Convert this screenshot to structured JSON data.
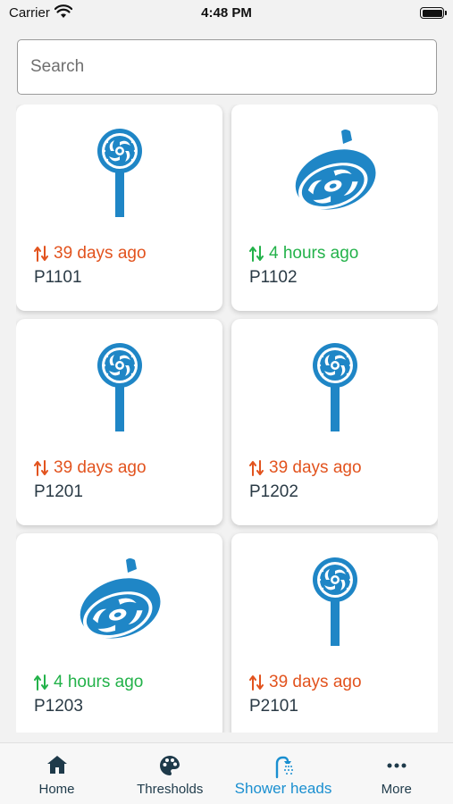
{
  "status_bar": {
    "carrier": "Carrier",
    "time": "4:48 PM"
  },
  "search": {
    "placeholder": "Search"
  },
  "colors": {
    "accent": "#1a8fd0",
    "stale": "#e2531e",
    "fresh": "#23b24a",
    "icon": "#1f86c6"
  },
  "cards": [
    {
      "id": "P1101",
      "time": "39 days ago",
      "status": "stale",
      "icon": "handheld-shower-head-icon"
    },
    {
      "id": "P1102",
      "time": "4 hours ago",
      "status": "fresh",
      "icon": "rain-shower-head-icon"
    },
    {
      "id": "P1201",
      "time": "39 days ago",
      "status": "stale",
      "icon": "handheld-shower-head-icon"
    },
    {
      "id": "P1202",
      "time": "39 days ago",
      "status": "stale",
      "icon": "handheld-shower-head-icon"
    },
    {
      "id": "P1203",
      "time": "4 hours ago",
      "status": "fresh",
      "icon": "rain-shower-head-icon"
    },
    {
      "id": "P2101",
      "time": "39 days ago",
      "status": "stale",
      "icon": "handheld-shower-head-icon"
    }
  ],
  "tabs": [
    {
      "label": "Home",
      "icon": "home-icon",
      "active": false
    },
    {
      "label": "Thresholds",
      "icon": "palette-icon",
      "active": false
    },
    {
      "label": "Shower heads",
      "icon": "shower-icon",
      "active": true
    },
    {
      "label": "More",
      "icon": "more-dots-icon",
      "active": false
    }
  ]
}
